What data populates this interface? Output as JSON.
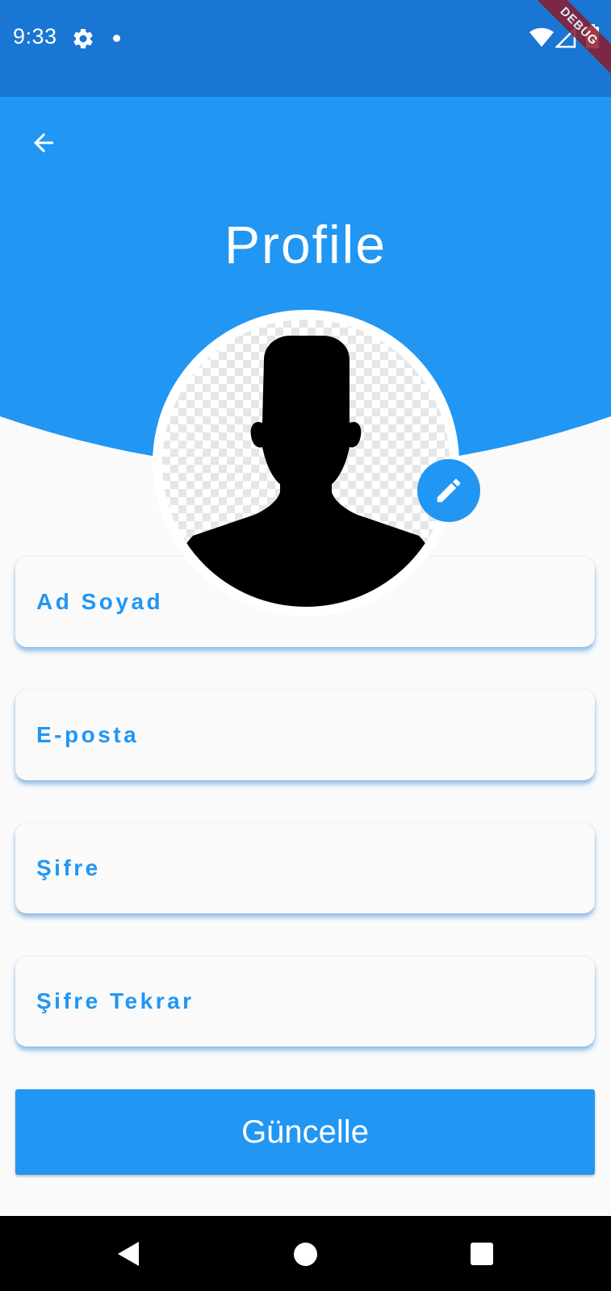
{
  "status_bar": {
    "time": "9:33",
    "color": "#1976d2",
    "icons": [
      "settings-icon",
      "notification-dot-icon",
      "wifi-icon",
      "signal-icon",
      "battery-icon"
    ]
  },
  "debug_banner": "DEBUG",
  "header": {
    "title": "Profile",
    "color": "#2196f3",
    "back_icon": "arrow-back-icon"
  },
  "avatar": {
    "image": "person-silhouette",
    "edit_icon": "pencil-icon"
  },
  "form": {
    "fields": [
      {
        "label": "Ad Soyad"
      },
      {
        "label": "E-posta"
      },
      {
        "label": "Şifre"
      },
      {
        "label": "Şifre Tekrar"
      }
    ],
    "label_color": "#2196f3"
  },
  "update_button": {
    "label": "Güncelle",
    "color": "#2196f3"
  },
  "nav_bar": {
    "icons": [
      "nav-back-icon",
      "nav-home-icon",
      "nav-recents-icon"
    ]
  }
}
